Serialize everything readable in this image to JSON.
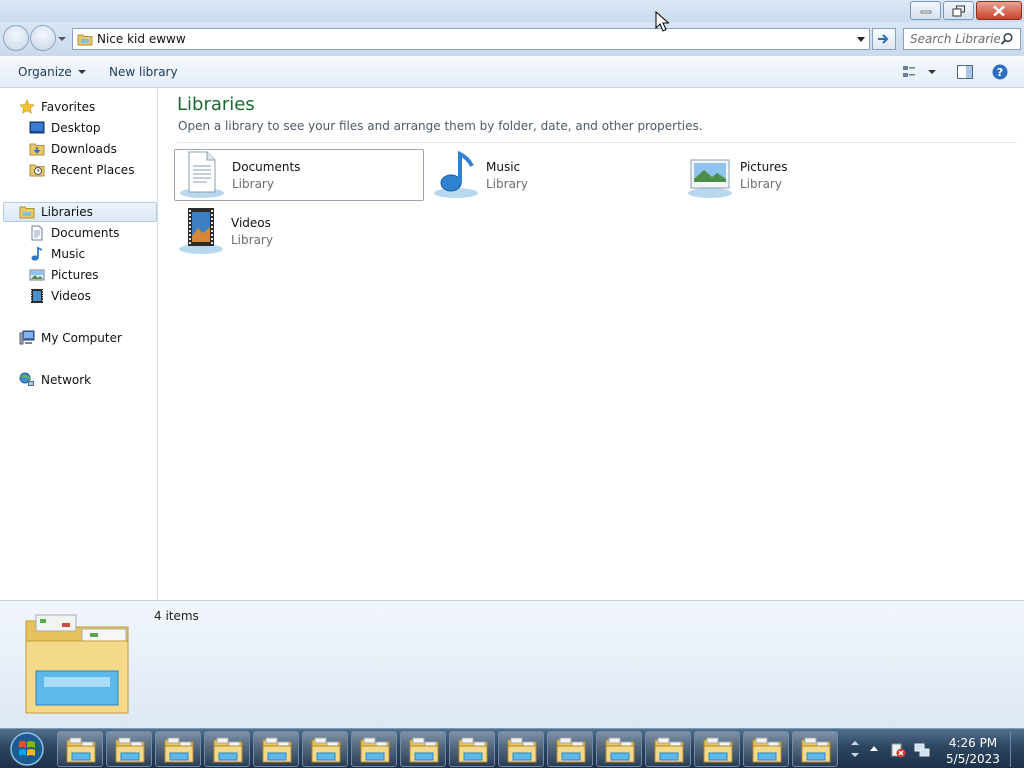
{
  "window": {
    "caption_buttons": [
      "minimize-icon",
      "restore-icon",
      "close-icon"
    ]
  },
  "navbar": {
    "address_value": "Nice kid ewww",
    "search_placeholder": "Search Libraries"
  },
  "commandbar": {
    "organize_label": "Organize",
    "new_library_label": "New library"
  },
  "navpane": {
    "favorites_label": "Favorites",
    "favorites": [
      "Desktop",
      "Downloads",
      "Recent Places"
    ],
    "libraries_label": "Libraries",
    "libraries": [
      "Documents",
      "Music",
      "Pictures",
      "Videos"
    ],
    "computer_label": "My Computer",
    "network_label": "Network"
  },
  "content": {
    "title": "Libraries",
    "subtitle": "Open a library to see your files and arrange them by folder, date, and other properties.",
    "tiles": [
      {
        "name": "Documents",
        "type": "Library",
        "icon": "documents-library-icon"
      },
      {
        "name": "Music",
        "type": "Library",
        "icon": "music-library-icon"
      },
      {
        "name": "Pictures",
        "type": "Library",
        "icon": "pictures-library-icon"
      },
      {
        "name": "Videos",
        "type": "Library",
        "icon": "videos-library-icon"
      }
    ]
  },
  "details": {
    "item_count": "4 items"
  },
  "taskbar": {
    "open_windows": 16,
    "time": "4:26 PM",
    "date": "5/5/2023"
  },
  "colors": {
    "title_green": "#1c6a2f",
    "command_text": "#1e395b",
    "taskbar": "#2d4661"
  }
}
